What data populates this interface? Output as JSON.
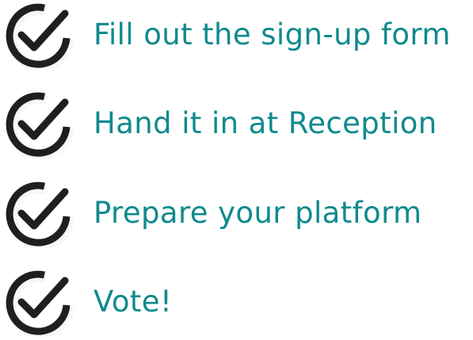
{
  "colors": {
    "text": "#0f8a8d",
    "icon": "#1f1f22"
  },
  "checklist": {
    "items": [
      {
        "label": "Fill out the sign-up form",
        "icon": "check-circle-icon"
      },
      {
        "label": "Hand it in at Reception",
        "icon": "check-circle-icon"
      },
      {
        "label": "Prepare your platform",
        "icon": "check-circle-icon"
      },
      {
        "label": "Vote!",
        "icon": "check-circle-icon"
      }
    ]
  }
}
